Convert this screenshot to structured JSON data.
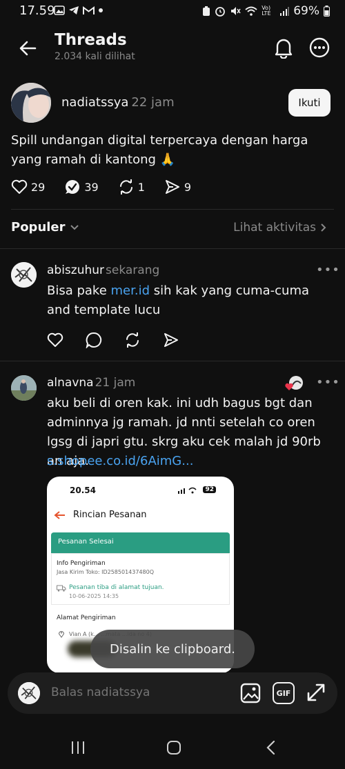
{
  "status_bar": {
    "time": "17.59",
    "battery": "69%",
    "network": "Vo) LTE"
  },
  "header": {
    "title": "Threads",
    "subtitle": "2.034 kali dilihat"
  },
  "post": {
    "username": "nadiatssya",
    "time": "22 jam",
    "follow_label": "Ikuti",
    "text": "Spill undangan digital terpercaya dengan harga yang ramah di kantong 🙏",
    "likes": "29",
    "comments": "39",
    "reposts": "1",
    "shares": "9"
  },
  "sort": {
    "label": "Populer",
    "activity_label": "Lihat aktivitas"
  },
  "replies": [
    {
      "username": "abiszuhur",
      "time": "sekarang",
      "text_before": "Bisa pake ",
      "link": "mer.id",
      "text_after": " sih kak yang cuma-cuma and template lucu"
    },
    {
      "username": "alnavna",
      "time": "21 jam",
      "text": "aku beli di oren kak. ini udh bagus bgt dan adminnya jg ramah. jd nnti setelah co oren lgsg di japri gtu. skrg aku cek malah jd 90rb an aja.",
      "link": "s.shopee.co.id/6AimG..."
    }
  ],
  "screenshot": {
    "time": "20.54",
    "battery": "92",
    "title": "Rincian Pesanan",
    "status": "Pesanan Selesai",
    "ship_info": "Info Pengiriman",
    "courier": "Jasa Kirim Toko: ID258501437480Q",
    "arrived": "Pesanan tiba di alamat tujuan.",
    "arrived_time": "10-06-2025 14:35",
    "address_title": "Alamat Pengiriman",
    "address": "Vian A (k... ...mata ...ida no 4)"
  },
  "toast": "Disalin ke clipboard.",
  "reply_bar": {
    "placeholder": "Balas nadiatssya",
    "gif_label": "GIF"
  },
  "colors": {
    "background": "#101010",
    "link": "#4aa3f0",
    "muted": "#8a8a8a",
    "accent_green": "#2a9d82"
  }
}
